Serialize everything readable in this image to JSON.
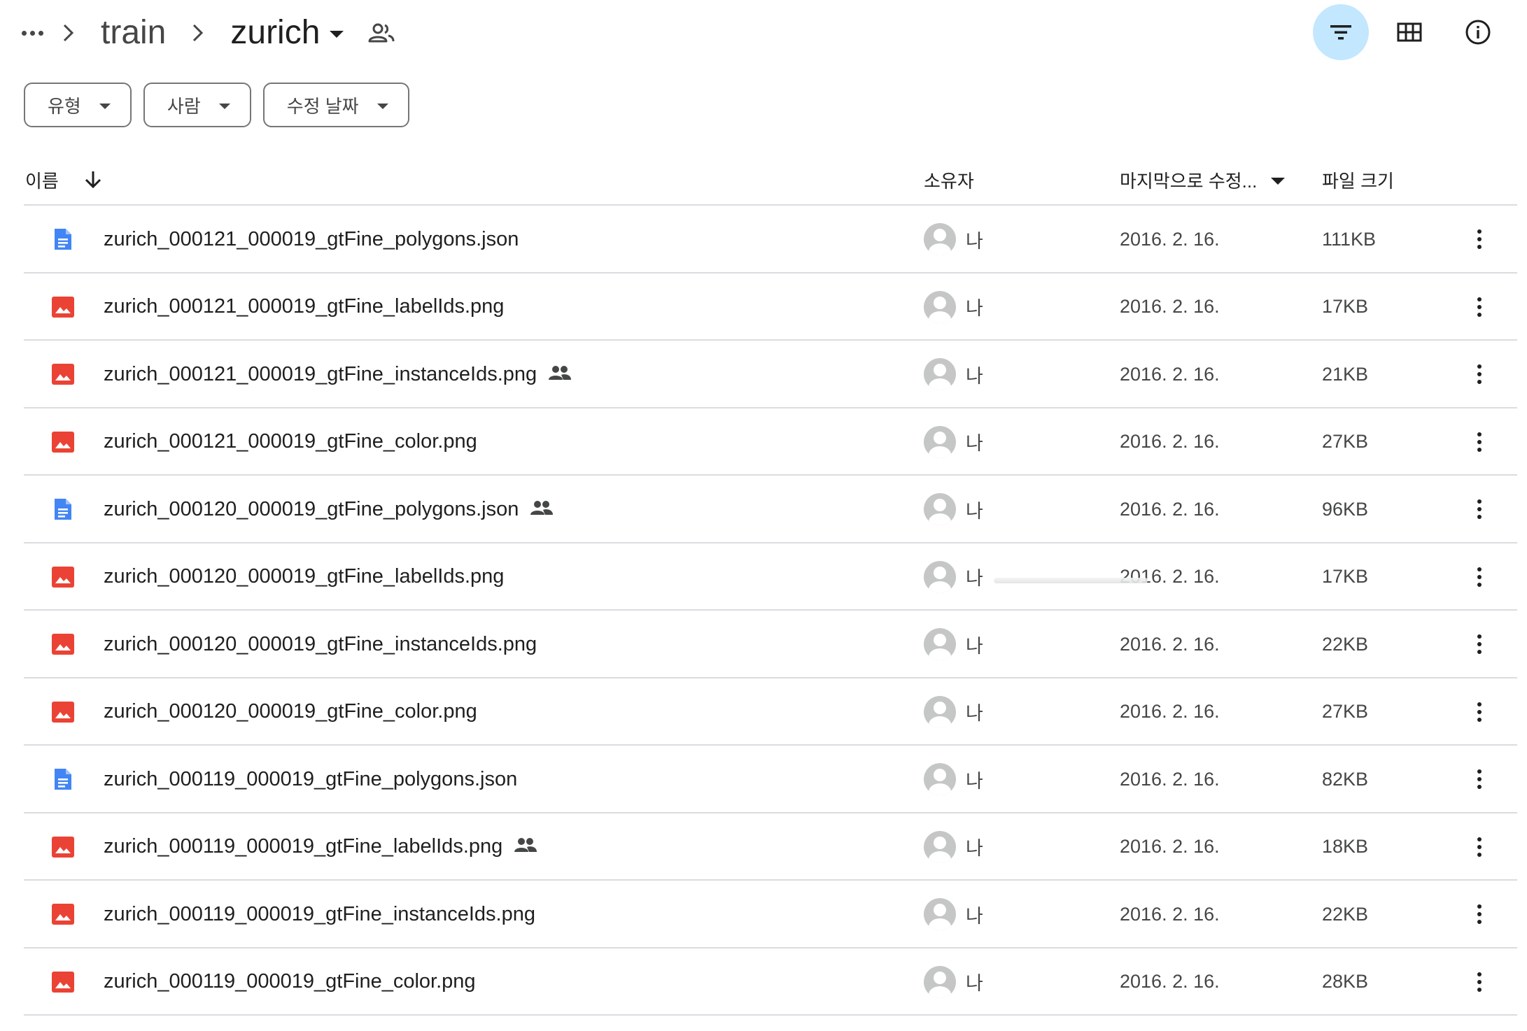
{
  "breadcrumb": {
    "items": [
      "train",
      "zurich"
    ]
  },
  "filters": [
    {
      "label": "유형"
    },
    {
      "label": "사람"
    },
    {
      "label": "수정 날짜"
    }
  ],
  "table": {
    "columns": {
      "name": "이름",
      "owner": "소유자",
      "modified": "마지막으로 수정...",
      "size": "파일 크기"
    },
    "rows": [
      {
        "type": "doc",
        "name": "zurich_000121_000019_gtFine_polygons.json",
        "shared": false,
        "owner": "나",
        "modified": "2016. 2. 16.",
        "size": "111KB"
      },
      {
        "type": "image",
        "name": "zurich_000121_000019_gtFine_labelIds.png",
        "shared": false,
        "owner": "나",
        "modified": "2016. 2. 16.",
        "size": "17KB"
      },
      {
        "type": "image",
        "name": "zurich_000121_000019_gtFine_instanceIds.png",
        "shared": true,
        "owner": "나",
        "modified": "2016. 2. 16.",
        "size": "21KB"
      },
      {
        "type": "image",
        "name": "zurich_000121_000019_gtFine_color.png",
        "shared": false,
        "owner": "나",
        "modified": "2016. 2. 16.",
        "size": "27KB"
      },
      {
        "type": "doc",
        "name": "zurich_000120_000019_gtFine_polygons.json",
        "shared": true,
        "owner": "나",
        "modified": "2016. 2. 16.",
        "size": "96KB"
      },
      {
        "type": "image",
        "name": "zurich_000120_000019_gtFine_labelIds.png",
        "shared": false,
        "owner": "나",
        "modified": "2016. 2. 16.",
        "size": "17KB"
      },
      {
        "type": "image",
        "name": "zurich_000120_000019_gtFine_instanceIds.png",
        "shared": false,
        "owner": "나",
        "modified": "2016. 2. 16.",
        "size": "22KB"
      },
      {
        "type": "image",
        "name": "zurich_000120_000019_gtFine_color.png",
        "shared": false,
        "owner": "나",
        "modified": "2016. 2. 16.",
        "size": "27KB"
      },
      {
        "type": "doc",
        "name": "zurich_000119_000019_gtFine_polygons.json",
        "shared": false,
        "owner": "나",
        "modified": "2016. 2. 16.",
        "size": "82KB"
      },
      {
        "type": "image",
        "name": "zurich_000119_000019_gtFine_labelIds.png",
        "shared": true,
        "owner": "나",
        "modified": "2016. 2. 16.",
        "size": "18KB"
      },
      {
        "type": "image",
        "name": "zurich_000119_000019_gtFine_instanceIds.png",
        "shared": false,
        "owner": "나",
        "modified": "2016. 2. 16.",
        "size": "22KB"
      },
      {
        "type": "image",
        "name": "zurich_000119_000019_gtFine_color.png",
        "shared": false,
        "owner": "나",
        "modified": "2016. 2. 16.",
        "size": "28KB"
      }
    ]
  },
  "colors": {
    "doc_icon": "#4285f4",
    "image_icon": "#ea4335",
    "active_button_bg": "#c2e7ff",
    "divider": "#dadce0"
  },
  "icons": {
    "breadcrumb_more": "more-horiz-icon",
    "breadcrumb_separator": "chevron-right-icon",
    "folder_shared": "people-outline-icon",
    "filter": "filter-list-icon",
    "grid_view": "grid-view-icon",
    "details": "info-icon",
    "sort_name": "arrow-downward-icon",
    "row_menu": "more-vert-icon"
  }
}
